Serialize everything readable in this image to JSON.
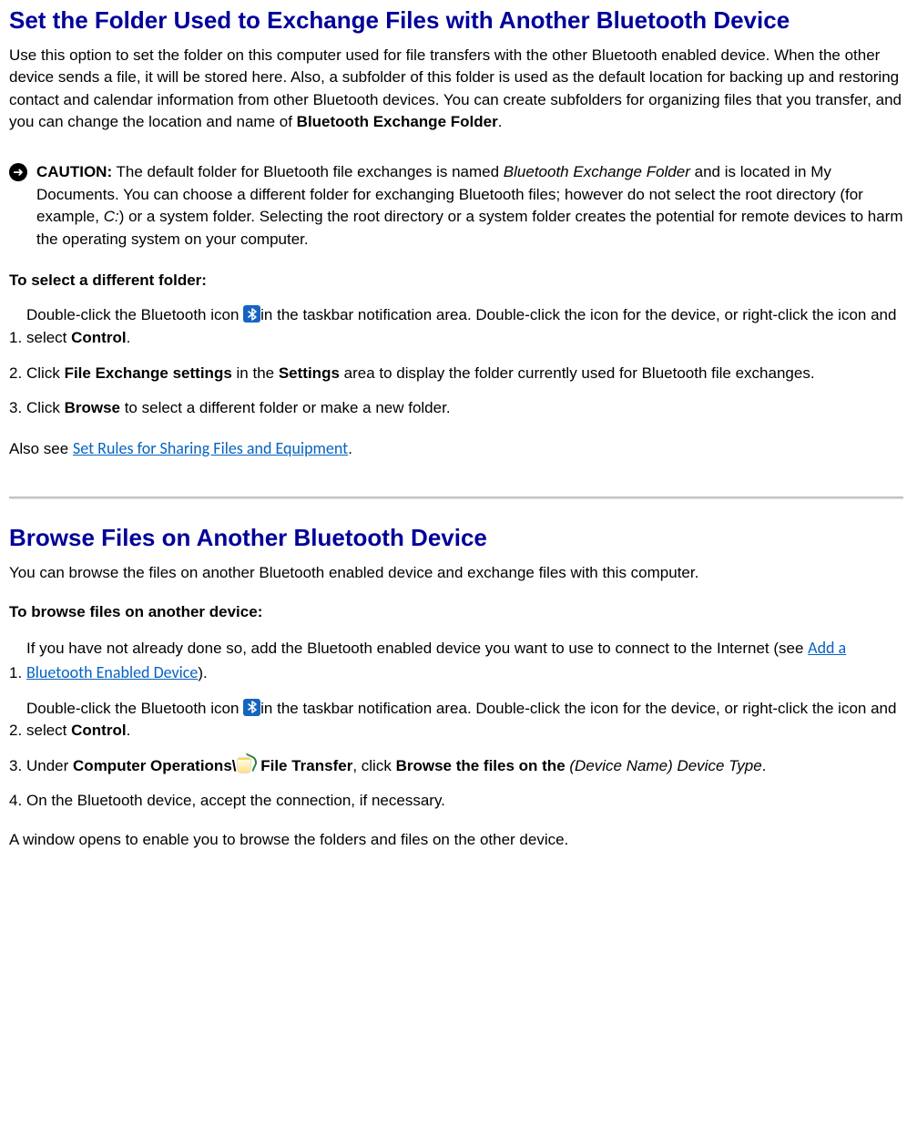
{
  "section1": {
    "heading": "Set the Folder Used to Exchange Files with Another Bluetooth Device",
    "intro_pre": "Use this option to set the folder on this computer used for file transfers with the other Bluetooth enabled device. When the other device sends a file, it will be stored here. Also, a subfolder of this folder is used as the default location for backing up and restoring contact and calendar information from other Bluetooth devices. You can create subfolders for organizing files that you transfer, and you can change the location and name of ",
    "intro_bold": "Bluetooth Exchange Folder",
    "intro_post": ".",
    "caution_label": "CAUTION:",
    "caution_t1": " The default folder for Bluetooth file exchanges is named ",
    "caution_i1": "Bluetooth Exchange Folder",
    "caution_t2": " and is located in My Documents. You can choose a different folder for exchanging Bluetooth files; however do not select the root directory (for example, ",
    "caution_i2": "C:",
    "caution_t3": ") or a system folder. Selecting the root directory or a system folder creates the potential for remote devices to harm the operating system on your computer.",
    "subhead": "To select a different folder:",
    "steps": {
      "s1_n": "1.",
      "s1_pre": "Double-click the Bluetooth icon ",
      "s1_mid": "in the taskbar notification area. Double-click the icon for the device, or right-click the icon and select ",
      "s1_b": "Control",
      "s1_post": ".",
      "s2_n": "2.",
      "s2_t1": "Click ",
      "s2_b1": "File Exchange settings",
      "s2_t2": " in the ",
      "s2_b2": "Settings",
      "s2_t3": " area to display the folder currently used for Bluetooth file exchanges.",
      "s3_n": "3.",
      "s3_t1": "Click ",
      "s3_b1": "Browse",
      "s3_t2": " to select a different folder or make a new folder."
    },
    "also_see_pre": "Also see ",
    "also_see_link": "Set Rules for Sharing Files and Equipment",
    "also_see_post": "."
  },
  "section2": {
    "heading": "Browse Files on Another Bluetooth Device",
    "intro": "You can browse the files on another Bluetooth enabled device and exchange files with this computer.",
    "subhead": "To browse files on another device:",
    "steps": {
      "s1_n": "1.",
      "s1_t1": "If you have not already done so, add the Bluetooth enabled device you want to use to connect to the Internet (see ",
      "s1_link": "Add a Bluetooth Enabled Device",
      "s1_t2": ").",
      "s2_n": "2.",
      "s2_pre": "Double-click the Bluetooth icon ",
      "s2_mid": "in the taskbar notification area. Double-click the icon for the device, or right-click the icon and select ",
      "s2_b": "Control",
      "s2_post": ".",
      "s3_n": "3.",
      "s3_t1": "Under ",
      "s3_b1": "Computer Operations\\",
      "s3_b2": " File Transfer",
      "s3_t2": ", click ",
      "s3_b3": "Browse the files on the ",
      "s3_i1": "(Device Name) Device Type",
      "s3_t3": ".",
      "s4_n": "4.",
      "s4_t": "On the Bluetooth device, accept the connection, if necessary."
    },
    "final": "A window opens to enable you to browse the folders and files on the other device."
  }
}
